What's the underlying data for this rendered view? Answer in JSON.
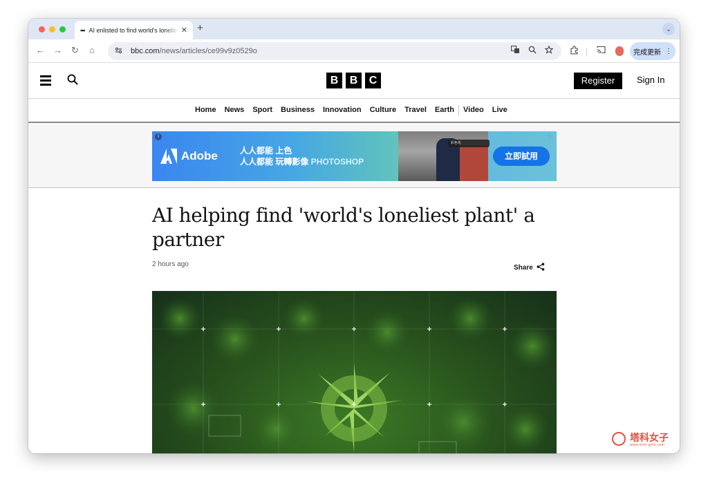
{
  "browser": {
    "tab": {
      "favicon": "•••",
      "title": "AI enlisted to find world's loneliest plant",
      "close": "✕"
    },
    "new_tab": "+",
    "tab_menu": "⌄",
    "nav": {
      "back": "←",
      "forward": "→",
      "reload": "↻",
      "home": "⌂"
    },
    "url_host": "bbc.com",
    "url_path": "/news/articles/ce99v9z0529o",
    "finish_button": "完成更新",
    "finish_menu": "⋮"
  },
  "header": {
    "logo": [
      "B",
      "B",
      "C"
    ],
    "register": "Register",
    "sign_in": "Sign In"
  },
  "nav": {
    "items": [
      "Home",
      "News",
      "Sport",
      "Business",
      "Innovation",
      "Culture",
      "Travel",
      "Earth",
      "Video",
      "Live"
    ]
  },
  "ad": {
    "brand": "Adobe",
    "line1": "人人都能 上色",
    "line2_a": "人人都能 玩轉影像 ",
    "line2_b": "PHOTOSHOP",
    "photo_ui": "彩色化",
    "cta": "立即試用",
    "choices": "▷"
  },
  "article": {
    "headline": "AI helping find 'world's loneliest plant' a partner",
    "timestamp": "2 hours ago",
    "share": "Share"
  },
  "watermark": {
    "text": "塔科女子",
    "subtext": "www.tech-girlz.com"
  },
  "colors": {
    "tab_strip": "#dfe7f5",
    "ad_cta": "#1473e6",
    "bbc_black": "#000000"
  }
}
